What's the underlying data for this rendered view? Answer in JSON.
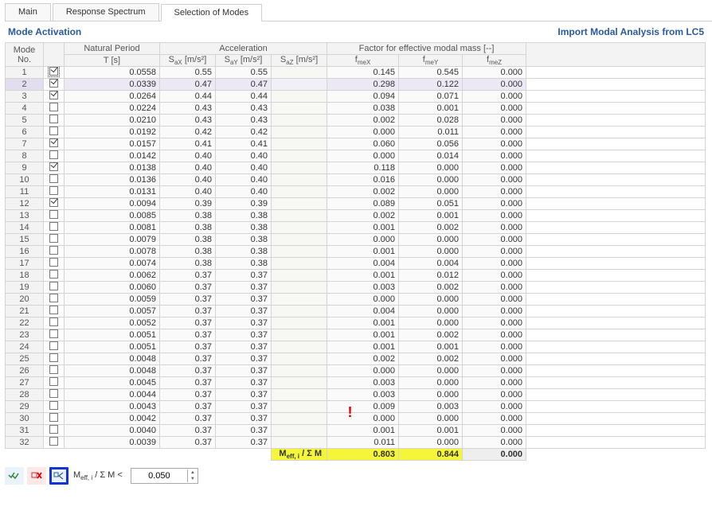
{
  "tabs": [
    "Main",
    "Response Spectrum",
    "Selection of Modes"
  ],
  "active_tab": 2,
  "section_title": "Mode Activation",
  "import_link": "Import Modal Analysis from LC5",
  "headers": {
    "mode": "Mode\nNo.",
    "period_group": "Natural Period",
    "period": "T [s]",
    "accel_group": "Acceleration",
    "sax": "SaX [m/s²]",
    "say": "SaY [m/s²]",
    "saz": "SaZ [m/s²]",
    "factor_group": "Factor for effective modal mass [--]",
    "fmex": "fmeX",
    "fmey": "fmeY",
    "fmez": "fmeZ"
  },
  "rows": [
    {
      "n": 1,
      "chk": true,
      "focus": true,
      "T": "0.0558",
      "sax": "0.55",
      "say": "0.55",
      "fx": "0.145",
      "fy": "0.545",
      "fz": "0.000"
    },
    {
      "n": 2,
      "chk": true,
      "hl": true,
      "T": "0.0339",
      "sax": "0.47",
      "say": "0.47",
      "fx": "0.298",
      "fy": "0.122",
      "fz": "0.000"
    },
    {
      "n": 3,
      "chk": true,
      "T": "0.0264",
      "sax": "0.44",
      "say": "0.44",
      "fx": "0.094",
      "fy": "0.071",
      "fz": "0.000"
    },
    {
      "n": 4,
      "chk": false,
      "T": "0.0224",
      "sax": "0.43",
      "say": "0.43",
      "fx": "0.038",
      "fy": "0.001",
      "fz": "0.000"
    },
    {
      "n": 5,
      "chk": false,
      "T": "0.0210",
      "sax": "0.43",
      "say": "0.43",
      "fx": "0.002",
      "fy": "0.028",
      "fz": "0.000"
    },
    {
      "n": 6,
      "chk": false,
      "T": "0.0192",
      "sax": "0.42",
      "say": "0.42",
      "fx": "0.000",
      "fy": "0.011",
      "fz": "0.000"
    },
    {
      "n": 7,
      "chk": true,
      "T": "0.0157",
      "sax": "0.41",
      "say": "0.41",
      "fx": "0.060",
      "fy": "0.056",
      "fz": "0.000"
    },
    {
      "n": 8,
      "chk": false,
      "T": "0.0142",
      "sax": "0.40",
      "say": "0.40",
      "fx": "0.000",
      "fy": "0.014",
      "fz": "0.000"
    },
    {
      "n": 9,
      "chk": true,
      "T": "0.0138",
      "sax": "0.40",
      "say": "0.40",
      "fx": "0.118",
      "fy": "0.000",
      "fz": "0.000"
    },
    {
      "n": 10,
      "chk": false,
      "T": "0.0136",
      "sax": "0.40",
      "say": "0.40",
      "fx": "0.016",
      "fy": "0.000",
      "fz": "0.000"
    },
    {
      "n": 11,
      "chk": false,
      "T": "0.0131",
      "sax": "0.40",
      "say": "0.40",
      "fx": "0.002",
      "fy": "0.000",
      "fz": "0.000"
    },
    {
      "n": 12,
      "chk": true,
      "T": "0.0094",
      "sax": "0.39",
      "say": "0.39",
      "fx": "0.089",
      "fy": "0.051",
      "fz": "0.000"
    },
    {
      "n": 13,
      "chk": false,
      "T": "0.0085",
      "sax": "0.38",
      "say": "0.38",
      "fx": "0.002",
      "fy": "0.001",
      "fz": "0.000"
    },
    {
      "n": 14,
      "chk": false,
      "T": "0.0081",
      "sax": "0.38",
      "say": "0.38",
      "fx": "0.001",
      "fy": "0.002",
      "fz": "0.000"
    },
    {
      "n": 15,
      "chk": false,
      "T": "0.0079",
      "sax": "0.38",
      "say": "0.38",
      "fx": "0.000",
      "fy": "0.000",
      "fz": "0.000"
    },
    {
      "n": 16,
      "chk": false,
      "T": "0.0078",
      "sax": "0.38",
      "say": "0.38",
      "fx": "0.001",
      "fy": "0.000",
      "fz": "0.000"
    },
    {
      "n": 17,
      "chk": false,
      "T": "0.0074",
      "sax": "0.38",
      "say": "0.38",
      "fx": "0.004",
      "fy": "0.004",
      "fz": "0.000"
    },
    {
      "n": 18,
      "chk": false,
      "T": "0.0062",
      "sax": "0.37",
      "say": "0.37",
      "fx": "0.001",
      "fy": "0.012",
      "fz": "0.000"
    },
    {
      "n": 19,
      "chk": false,
      "T": "0.0060",
      "sax": "0.37",
      "say": "0.37",
      "fx": "0.003",
      "fy": "0.002",
      "fz": "0.000"
    },
    {
      "n": 20,
      "chk": false,
      "T": "0.0059",
      "sax": "0.37",
      "say": "0.37",
      "fx": "0.000",
      "fy": "0.000",
      "fz": "0.000"
    },
    {
      "n": 21,
      "chk": false,
      "T": "0.0057",
      "sax": "0.37",
      "say": "0.37",
      "fx": "0.004",
      "fy": "0.000",
      "fz": "0.000"
    },
    {
      "n": 22,
      "chk": false,
      "T": "0.0052",
      "sax": "0.37",
      "say": "0.37",
      "fx": "0.001",
      "fy": "0.000",
      "fz": "0.000"
    },
    {
      "n": 23,
      "chk": false,
      "T": "0.0051",
      "sax": "0.37",
      "say": "0.37",
      "fx": "0.001",
      "fy": "0.002",
      "fz": "0.000"
    },
    {
      "n": 24,
      "chk": false,
      "T": "0.0051",
      "sax": "0.37",
      "say": "0.37",
      "fx": "0.001",
      "fy": "0.001",
      "fz": "0.000"
    },
    {
      "n": 25,
      "chk": false,
      "T": "0.0048",
      "sax": "0.37",
      "say": "0.37",
      "fx": "0.002",
      "fy": "0.002",
      "fz": "0.000"
    },
    {
      "n": 26,
      "chk": false,
      "T": "0.0048",
      "sax": "0.37",
      "say": "0.37",
      "fx": "0.000",
      "fy": "0.000",
      "fz": "0.000"
    },
    {
      "n": 27,
      "chk": false,
      "T": "0.0045",
      "sax": "0.37",
      "say": "0.37",
      "fx": "0.003",
      "fy": "0.000",
      "fz": "0.000"
    },
    {
      "n": 28,
      "chk": false,
      "T": "0.0044",
      "sax": "0.37",
      "say": "0.37",
      "fx": "0.003",
      "fy": "0.000",
      "fz": "0.000"
    },
    {
      "n": 29,
      "chk": false,
      "T": "0.0043",
      "sax": "0.37",
      "say": "0.37",
      "fx": "0.009",
      "fy": "0.003",
      "fz": "0.000"
    },
    {
      "n": 30,
      "chk": false,
      "T": "0.0042",
      "sax": "0.37",
      "say": "0.37",
      "fx": "0.000",
      "fy": "0.000",
      "fz": "0.000",
      "warn": true
    },
    {
      "n": 31,
      "chk": false,
      "T": "0.0040",
      "sax": "0.37",
      "say": "0.37",
      "fx": "0.001",
      "fy": "0.001",
      "fz": "0.000"
    },
    {
      "n": 32,
      "chk": false,
      "T": "0.0039",
      "sax": "0.37",
      "say": "0.37",
      "fx": "0.011",
      "fy": "0.000",
      "fz": "0.000"
    }
  ],
  "summary": {
    "label": "Meff, i / Σ M",
    "fx": "0.803",
    "fy": "0.844",
    "fz": "0.000"
  },
  "toolbar": {
    "select_all": "✓✓",
    "deselect": "✕",
    "filter": "≤",
    "label": "Meff, i / Σ M <",
    "value": "0.050"
  }
}
